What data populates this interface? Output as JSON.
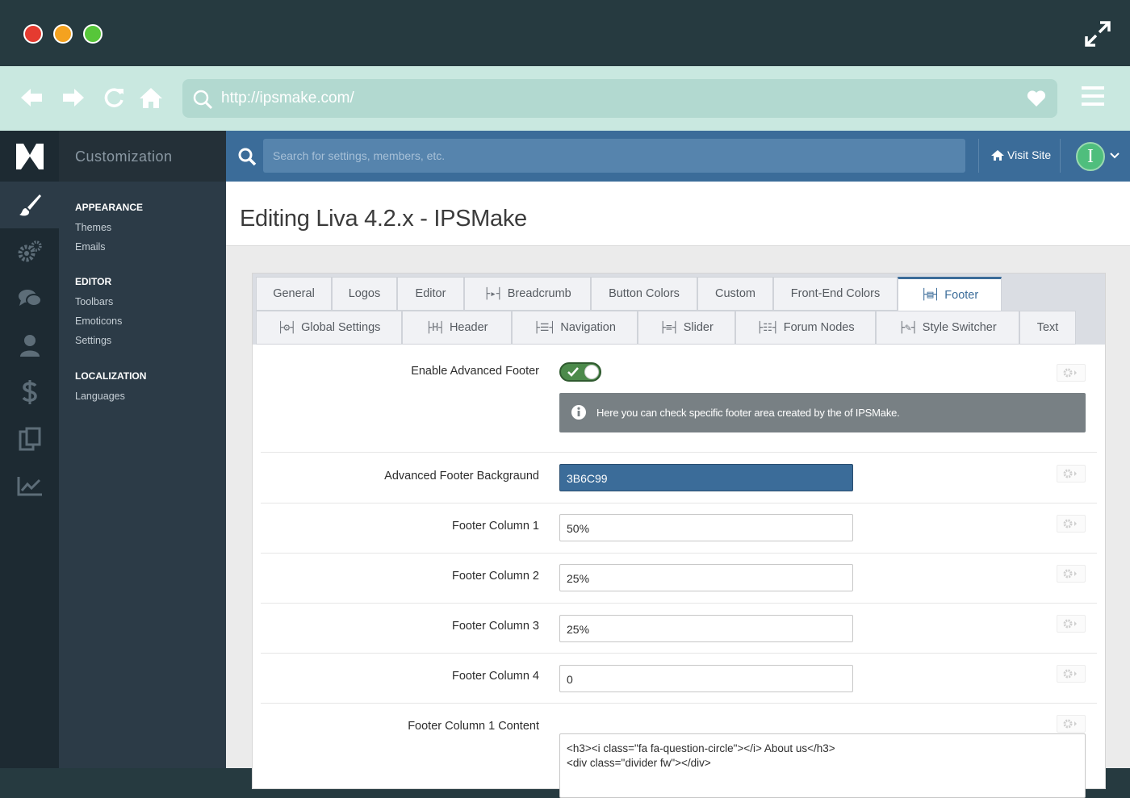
{
  "browser": {
    "url": "http://ipsmake.com/",
    "window_dots": [
      "#e53b30",
      "#f4a21f",
      "#57c63a"
    ]
  },
  "sidebar": {
    "title": "Customization",
    "groups": [
      {
        "heading": "APPEARANCE",
        "links": [
          "Themes",
          "Emails"
        ]
      },
      {
        "heading": "EDITOR",
        "links": [
          "Toolbars",
          "Emoticons",
          "Settings"
        ]
      },
      {
        "heading": "LOCALIZATION",
        "links": [
          "Languages"
        ]
      }
    ],
    "rail_icons": [
      "brush-icon",
      "gears-icon",
      "chat-bubbles-icon",
      "user-icon",
      "dollar-icon",
      "clipboard-icon",
      "chart-line-icon"
    ]
  },
  "topbar": {
    "search_placeholder": "Search for settings, members, etc.",
    "visit_site": "Visit Site",
    "avatar_letter": "I"
  },
  "page": {
    "title": "Editing Liva 4.2.x - IPSMake"
  },
  "tabs": {
    "row1": [
      {
        "label": "General",
        "icon": ""
      },
      {
        "label": "Logos",
        "icon": ""
      },
      {
        "label": "Editor",
        "icon": ""
      },
      {
        "label": "Breadcrumb",
        "icon": "├▸┤"
      },
      {
        "label": "Button Colors",
        "icon": ""
      },
      {
        "label": "Custom",
        "icon": ""
      },
      {
        "label": "Front-End Colors",
        "icon": ""
      },
      {
        "label": "Footer",
        "icon": "├▤┤"
      }
    ],
    "row2": [
      {
        "label": "Global Settings",
        "icon": "├⚙┤"
      },
      {
        "label": "Header",
        "icon": "├H┤"
      },
      {
        "label": "Navigation",
        "icon": "├☰┤"
      },
      {
        "label": "Slider",
        "icon": "├≡┤"
      },
      {
        "label": "Forum Nodes",
        "icon": "├☷┤"
      },
      {
        "label": "Style Switcher",
        "icon": "├✎┤"
      },
      {
        "label": "Text",
        "icon": ""
      }
    ],
    "active": "Footer"
  },
  "settings": {
    "enable_footer": {
      "label": "Enable Advanced Footer",
      "on": true
    },
    "info": "Here you can check specific footer area created by the of IPSMake.",
    "background": {
      "label": "Advanced Footer Backgraund",
      "value": "3B6C99"
    },
    "columns": [
      {
        "label": "Footer Column 1",
        "value": "50%"
      },
      {
        "label": "Footer Column 2",
        "value": "25%"
      },
      {
        "label": "Footer Column 3",
        "value": "25%"
      },
      {
        "label": "Footer Column 4",
        "value": "0"
      }
    ],
    "content": {
      "label": "Footer Column 1 Content",
      "lines": [
        "<h3><i class=\"fa fa-question-circle\"></i> About us</h3>",
        "<div class=\"divider fw\"></div>"
      ]
    }
  }
}
